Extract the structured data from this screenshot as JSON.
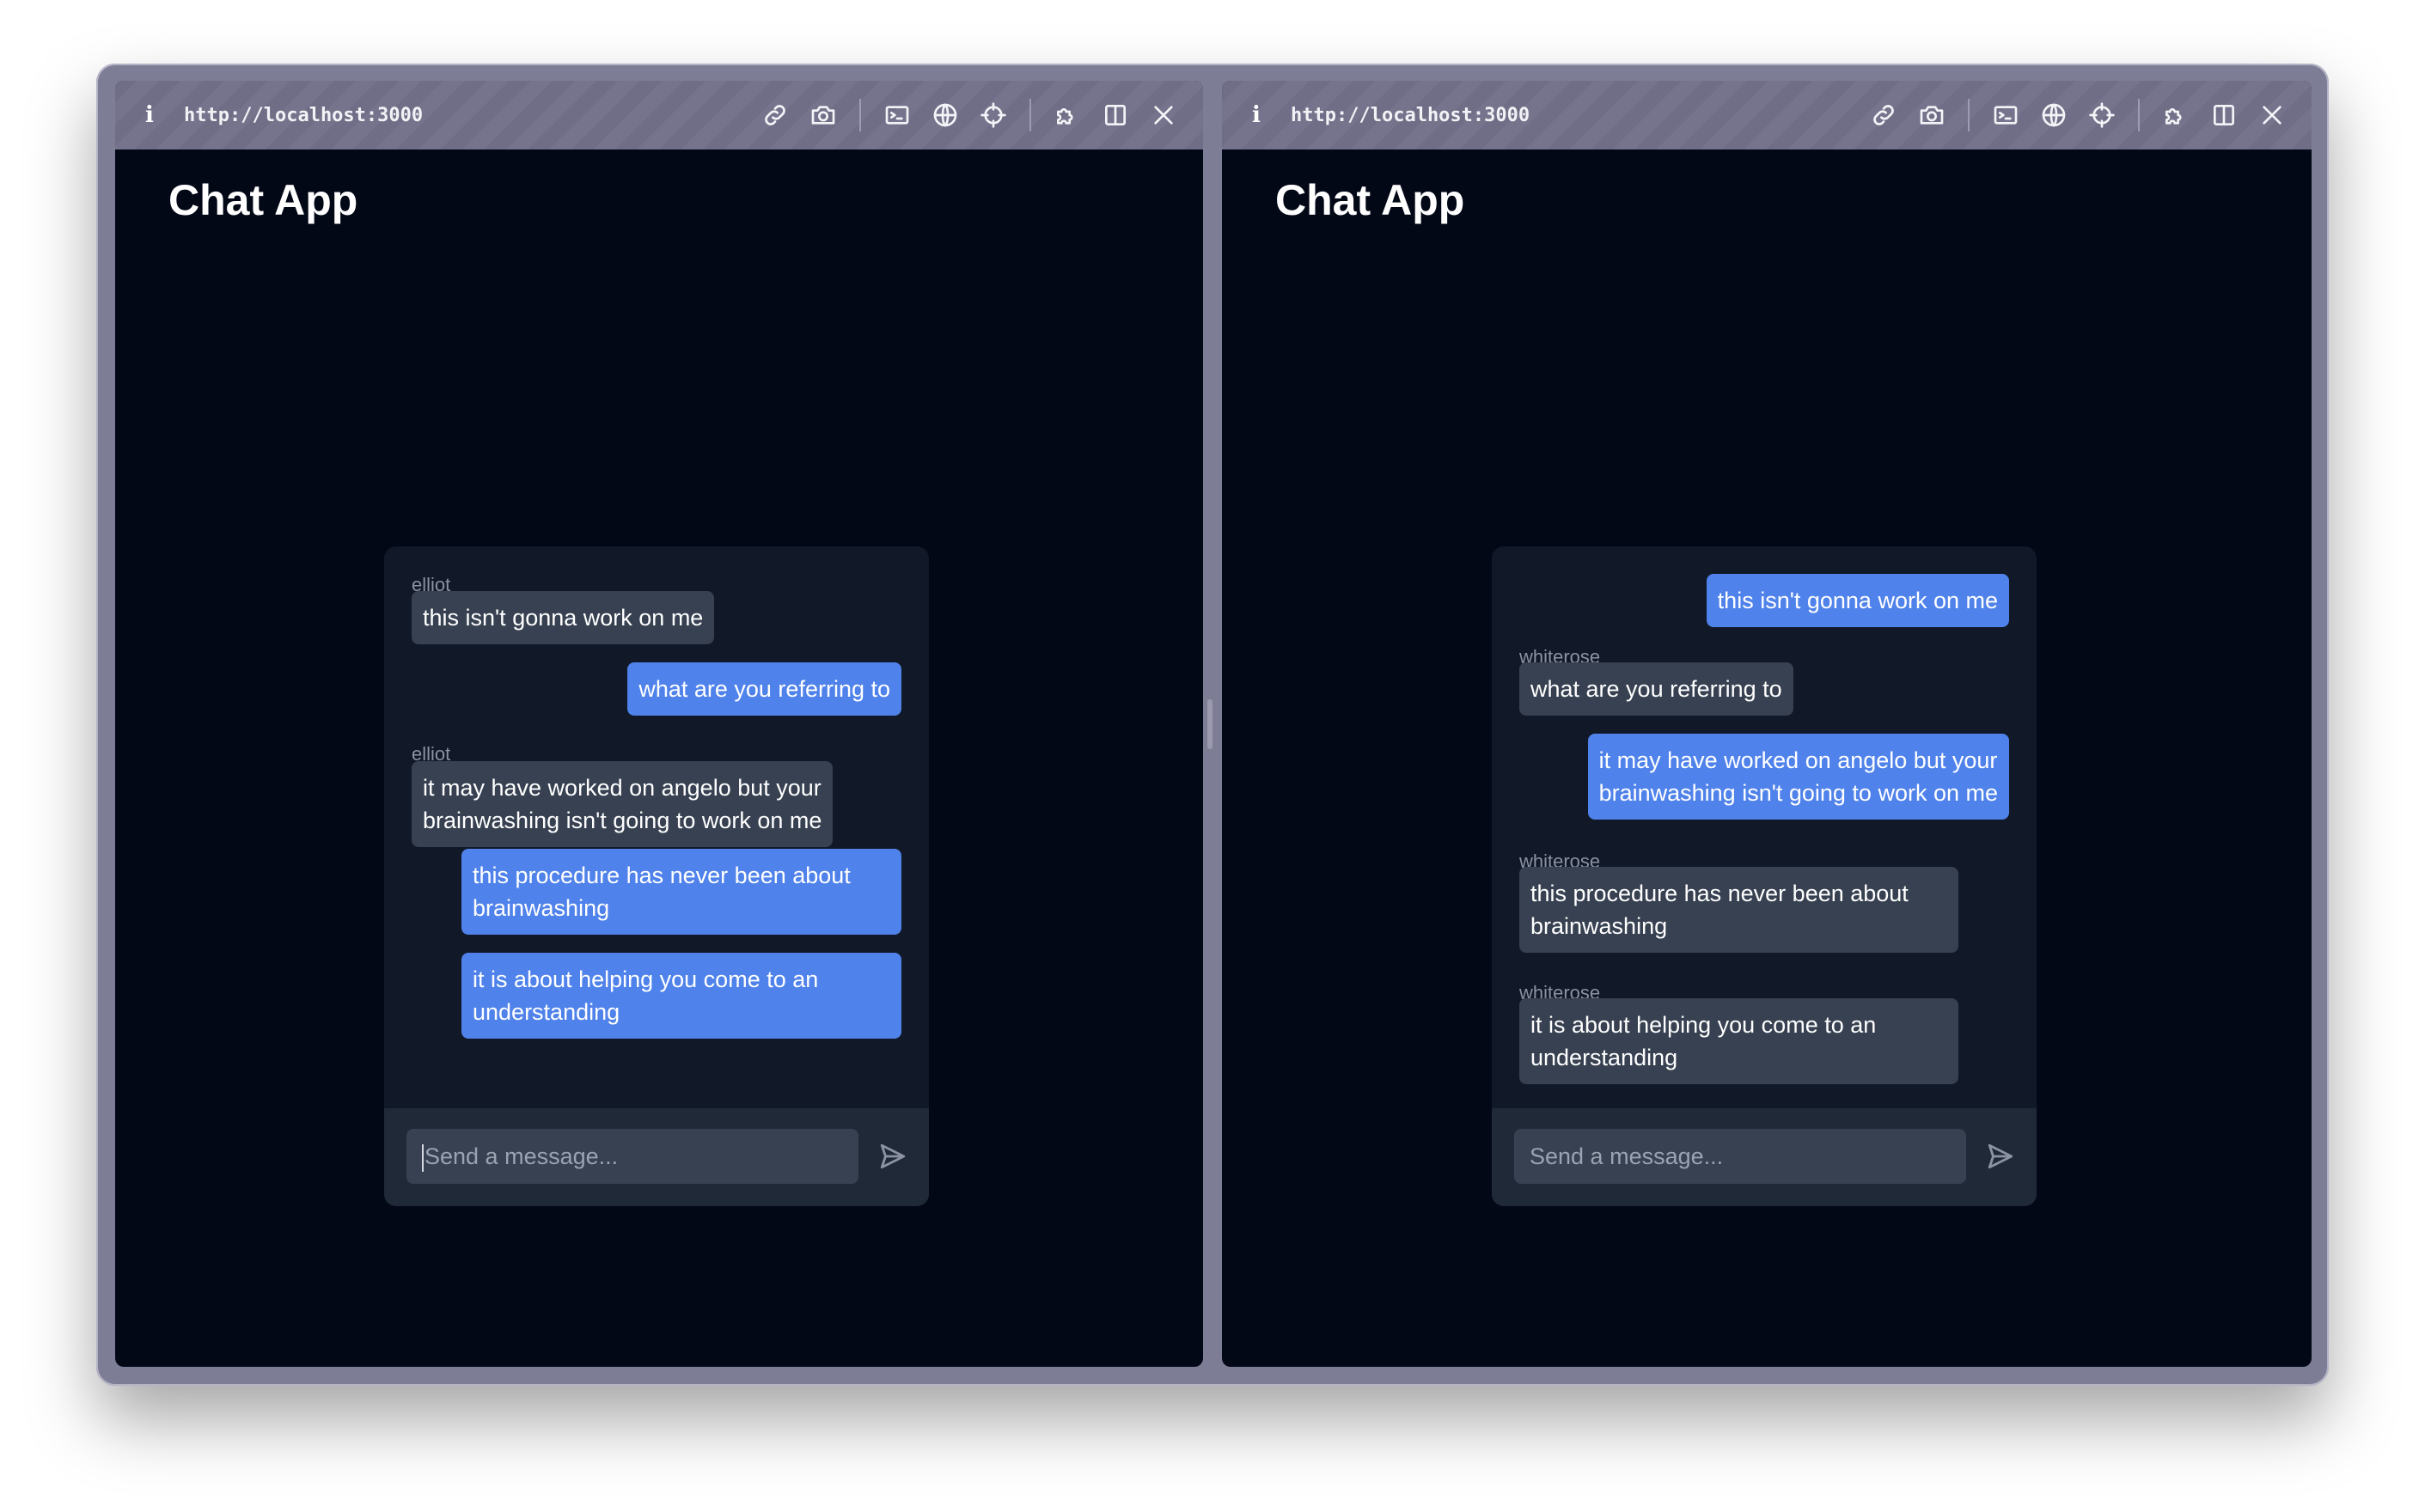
{
  "window": {
    "panes": [
      {
        "url": "http://localhost:3000",
        "title": "Chat App",
        "input_placeholder": "Send a message...",
        "messages": [
          {
            "sender": "elliot",
            "text_lines": [
              "this isn't gonna work on me"
            ],
            "direction": "in"
          },
          {
            "sender": "",
            "text_lines": [
              "what are you referring to"
            ],
            "direction": "out"
          },
          {
            "sender": "elliot",
            "text_lines": [
              "it may have worked on angelo but your",
              "brainwashing isn't going to work on me"
            ],
            "direction": "in"
          },
          {
            "sender": "",
            "text_lines": [
              "this procedure has never been about",
              "brainwashing"
            ],
            "direction": "out"
          },
          {
            "sender": "",
            "text_lines": [
              "it is about helping you come to an",
              "understanding"
            ],
            "direction": "out"
          }
        ]
      },
      {
        "url": "http://localhost:3000",
        "title": "Chat App",
        "input_placeholder": "Send a message...",
        "messages": [
          {
            "sender": "",
            "text_lines": [
              "this isn't gonna work on me"
            ],
            "direction": "out"
          },
          {
            "sender": "whiterose",
            "text_lines": [
              "what are you referring to"
            ],
            "direction": "in"
          },
          {
            "sender": "",
            "text_lines": [
              "it may have worked on angelo but your",
              "brainwashing isn't going to work on me"
            ],
            "direction": "out"
          },
          {
            "sender": "whiterose",
            "text_lines": [
              "this procedure has never been about",
              "brainwashing"
            ],
            "direction": "in"
          },
          {
            "sender": "whiterose",
            "text_lines": [
              "it is about helping you come to an",
              "understanding"
            ],
            "direction": "in"
          }
        ]
      }
    ],
    "toolbar_icons": [
      "info-icon",
      "link-icon",
      "camera-icon",
      "terminal-icon",
      "globe-icon",
      "crosshair-icon",
      "extension-icon",
      "split-view-icon",
      "close-icon"
    ]
  },
  "colors": {
    "frame": "#7e7d96",
    "page_background": "#030817",
    "card_background": "#111827",
    "composer_background": "#1f2937",
    "incoming_bubble": "#374151",
    "outgoing_bubble": "#4f82ea"
  }
}
